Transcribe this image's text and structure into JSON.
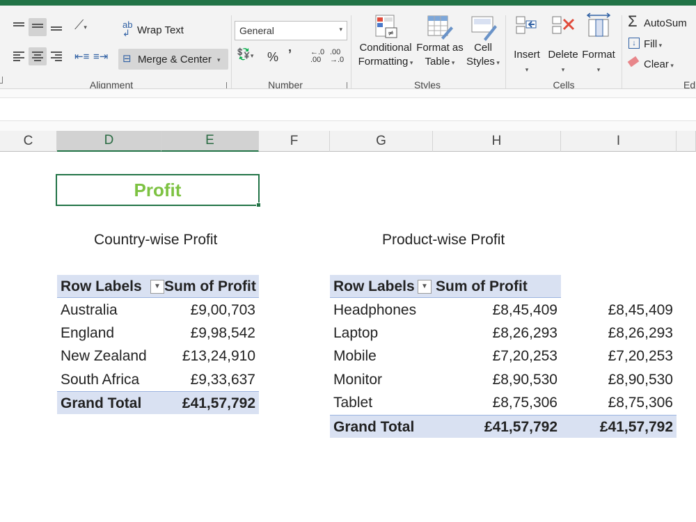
{
  "ribbon": {
    "alignment": {
      "wrap_text": "Wrap Text",
      "merge_center": "Merge & Center",
      "group_label": "Alignment"
    },
    "number": {
      "format_value": "General",
      "percent": "%",
      "comma": "’",
      "inc_decimal": "←.0\n.00",
      "dec_decimal": ".00\n→.0",
      "group_label": "Number"
    },
    "styles": {
      "conditional_1": "Conditional",
      "conditional_2": "Formatting",
      "format_table_1": "Format as",
      "format_table_2": "Table",
      "cell_styles_1": "Cell",
      "cell_styles_2": "Styles",
      "group_label": "Styles"
    },
    "cells": {
      "insert": "Insert",
      "delete": "Delete",
      "format": "Format",
      "group_label": "Cells"
    },
    "editing": {
      "autosum": "AutoSum",
      "fill": "Fill",
      "clear": "Clear",
      "group_label": "Ed"
    }
  },
  "columns": [
    "C",
    "D",
    "E",
    "F",
    "G",
    "H",
    "I"
  ],
  "sheet": {
    "title": "Profit",
    "country_table": {
      "caption": "Country-wise Profit",
      "header_label": "Row Labels",
      "header_value": "Sum of Profit",
      "rows": [
        {
          "label": "Australia",
          "value": "£9,00,703"
        },
        {
          "label": "England",
          "value": "£9,98,542"
        },
        {
          "label": "New Zealand",
          "value": "£13,24,910"
        },
        {
          "label": "South Africa",
          "value": "£9,33,637"
        }
      ],
      "total_label": "Grand Total",
      "total_value": "£41,57,792"
    },
    "product_table": {
      "caption": "Product-wise Profit",
      "header_label": "Row Labels",
      "header_value": "Sum of Profit",
      "rows": [
        {
          "label": "Headphones",
          "value": "£8,45,409",
          "extra": "£8,45,409"
        },
        {
          "label": "Laptop",
          "value": "£8,26,293",
          "extra": "£8,26,293"
        },
        {
          "label": "Mobile",
          "value": "£7,20,253",
          "extra": "£7,20,253"
        },
        {
          "label": "Monitor",
          "value": "£8,90,530",
          "extra": "£8,90,530"
        },
        {
          "label": "Tablet",
          "value": "£8,75,306",
          "extra": "£8,75,306"
        }
      ],
      "total_label": "Grand Total",
      "total_value": "£41,57,792",
      "total_extra": "£41,57,792"
    }
  },
  "colors": {
    "excel_green": "#217346",
    "title_green": "#7dc242",
    "pivot_header": "#d9e1f2"
  }
}
